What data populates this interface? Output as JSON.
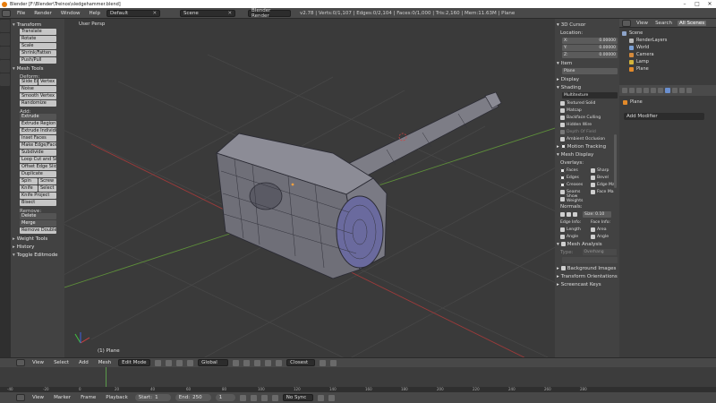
{
  "window": {
    "title": "Blender [F:\\Blender\\Treinos\\sledgehammer.blend]"
  },
  "menus": [
    "File",
    "Render",
    "Window",
    "Help"
  ],
  "layout_select": "Default",
  "scene_select": "Scene",
  "engine_select": "Blender Render",
  "stats": "v2.78 | Verts:0/1,107 | Edges:0/2,104 | Faces:0/1,000 | Tris:2,160 | Mem:11.63M | Plane",
  "toolshelf": {
    "transform_header": "Transform",
    "transform": [
      "Translate",
      "Rotate",
      "Scale",
      "Shrink/Fatten",
      "Push/Pull"
    ],
    "mesh_tools_header": "Mesh Tools",
    "deform_label": "Deform:",
    "slide_pair": [
      "Slide Ed",
      "Vertex"
    ],
    "deform": [
      "Noise",
      "Smooth Vertex",
      "Randomize"
    ],
    "add_label": "Add:",
    "extrude_dd": "Extrude",
    "add": [
      "Extrude Region",
      "Extrude Individual",
      "Inset Faces",
      "Make Edge/Face",
      "Subdivide",
      "Loop Cut and Slide",
      "Offset Edge Slide",
      "Duplicate"
    ],
    "spin_pair": [
      "Spin",
      "Screw"
    ],
    "knife_pair": [
      "Knife",
      "Select"
    ],
    "add2": [
      "Knife Project",
      "Bisect"
    ],
    "remove_label": "Remove:",
    "delete_dd": "Delete",
    "merge_dd": "Merge",
    "remove_doubles": "Remove Doubles",
    "weight_tools": "Weight Tools",
    "history": "History",
    "toggle": "Toggle Editmode"
  },
  "viewport": {
    "label": "User Persp",
    "object": "(1) Plane"
  },
  "npanel": {
    "cursor_header": "3D Cursor",
    "location_label": "Location:",
    "loc": [
      {
        "axis": "X:",
        "v": "0.00000"
      },
      {
        "axis": "Y:",
        "v": "0.00000"
      },
      {
        "axis": "Z:",
        "v": "0.00000"
      }
    ],
    "item_header": "Item",
    "item_name": "Plane",
    "display_header": "Display",
    "shading_header": "Shading",
    "shading_mode": "Multitexture",
    "shading_opts": [
      "Textured Solid",
      "Matcap",
      "Backface Culling",
      "Hidden Wire",
      "Depth Of Field",
      "Ambient Occlusion"
    ],
    "motion_tracking": "Motion Tracking",
    "mesh_display": "Mesh Display",
    "overlays_label": "Overlays:",
    "overlays_left": [
      "Faces",
      "Edges",
      "Creases",
      "Seams",
      "Show Weights"
    ],
    "overlays_right": [
      "Sharp",
      "Bevel",
      "Edge Ma",
      "Face Ma"
    ],
    "normals_label": "Normals:",
    "size_field": "Size: 0.10",
    "edge_info": "Edge Info:",
    "face_info": "Face Info:",
    "info_left": [
      "Length",
      "Angle"
    ],
    "info_right": [
      "Area",
      "Angle"
    ],
    "mesh_analysis": "Mesh Analysis",
    "type_label": "Type:",
    "type_value": "Overhang",
    "background_images": "Background Images",
    "transform_orientations": "Transform Orientations",
    "screencast_keys": "Screencast Keys"
  },
  "outliner": {
    "tabs": [
      "View",
      "Search",
      "All Scenes"
    ],
    "items": [
      {
        "label": "Scene",
        "color": "#8ea4c9",
        "indent": 0
      },
      {
        "label": "RenderLayers",
        "color": "#b9b9b9",
        "indent": 1
      },
      {
        "label": "World",
        "color": "#7aa0d6",
        "indent": 1
      },
      {
        "label": "Camera",
        "color": "#d48a3c",
        "indent": 1
      },
      {
        "label": "Lamp",
        "color": "#d4b53c",
        "indent": 1
      },
      {
        "label": "Plane",
        "color": "#e38a2a",
        "indent": 1
      }
    ]
  },
  "properties": {
    "object": "Plane",
    "add_modifier": "Add Modifier"
  },
  "view_header": {
    "items": [
      "View",
      "Select",
      "Add",
      "Mesh"
    ],
    "mode": "Edit Mode",
    "orientation": "Global",
    "proportional": "Closest"
  },
  "timeline": {
    "menus": [
      "View",
      "Marker",
      "Frame",
      "Playback"
    ],
    "start": "Start:",
    "start_v": "1",
    "end": "End:",
    "end_v": "250",
    "current": "1",
    "sync": "No Sync",
    "ruler": [
      "-40",
      "-20",
      "0",
      "20",
      "40",
      "60",
      "80",
      "100",
      "120",
      "140",
      "160",
      "180",
      "200",
      "220",
      "240",
      "260",
      "280"
    ]
  },
  "colors": {
    "accent": "#e87d0d",
    "selection": "#6a8fcf",
    "grid_x": "#a83b3b",
    "grid_y": "#5a8f3b"
  }
}
